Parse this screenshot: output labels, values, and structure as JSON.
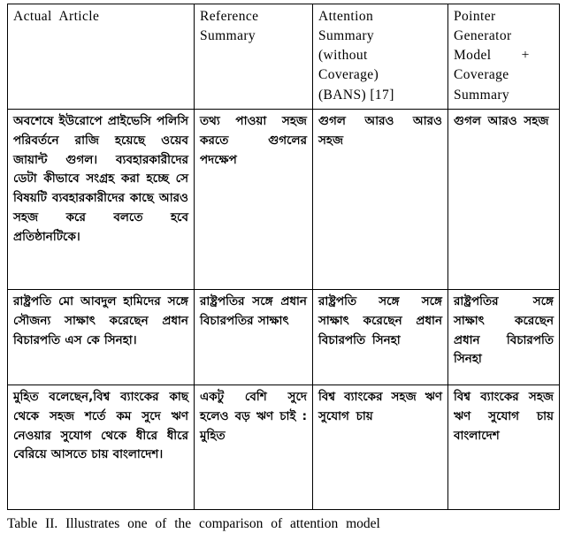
{
  "table": {
    "columns": [
      {
        "id": "actual-article",
        "header_lines": [
          "Actual  Article"
        ]
      },
      {
        "id": "reference-summary",
        "header_lines": [
          "Reference",
          "Summary"
        ]
      },
      {
        "id": "attention-summary",
        "header_lines": [
          "Attention",
          "Summary",
          "(without",
          "Coverage)",
          "(BANS) [17]"
        ]
      },
      {
        "id": "pointer-generator-summary",
        "header_lines": [
          "Pointer",
          "Generator",
          "Model        +",
          "Coverage",
          "Summary"
        ]
      }
    ],
    "rows": [
      {
        "actual_article": "অবশেষে ইউরোপে প্রাইভেসি পলিসি পরিবর্তনে রাজি হয়েছে ওয়েব জায়ান্ট গুগল। ব্যবহারকারীদের ডেটা কীভাবে সংগ্রহ করা হচ্ছে সে বিষয়টি ব্যবহারকারীদের কাছে আরও সহজ করে বলতে হবে প্রতিষ্ঠানটিকে।",
        "reference_summary": "তথ্য পাওয়া সহজ করতে গুগলের পদক্ষেপ",
        "attention_summary": "গুগল আরও আরও সহজ",
        "pointer_generator_summary": "গুগল আরও সহজ"
      },
      {
        "actual_article": "রাষ্ট্রপতি মো আবদুল হামিদের সঙ্গে সৌজন্য সাক্ষাৎ করেছেন প্রধান বিচারপতি এস কে সিনহা।",
        "reference_summary": "রাষ্ট্রপতির সঙ্গে প্রধান বিচারপতির সাক্ষাৎ",
        "attention_summary": "রাষ্ট্রপতি সঙ্গে সঙ্গে সাক্ষাৎ করেছেন প্রধান বিচারপতি সিনহা",
        "pointer_generator_summary": "রাষ্ট্রপতির সঙ্গে সাক্ষাৎ করেছেন প্রধান বিচারপতি সিনহা"
      },
      {
        "actual_article": "মুহিত বলেছেন,বিশ্ব ব্যাংকের কাছ থেকে সহজ শর্তে কম সুদে ঋণ নেওয়ার সুযোগ থেকে ধীরে ধীরে বেরিয়ে আসতে চায় বাংলাদেশ।",
        "reference_summary": "একটু বেশি সুদে হলেও বড় ঋণ চাই : মুহিত",
        "attention_summary": "বিশ্ব ব্যাংকের সহজ ঋণ সুযোগ চায়",
        "pointer_generator_summary": "বিশ্ব ব্যাংকের সহজ ঋণ সুযোগ চায় বাংলাদেশ"
      }
    ]
  },
  "caption": {
    "text": "Table  II.  Illustrates  one  of  the  comparison  of  attention  model"
  }
}
